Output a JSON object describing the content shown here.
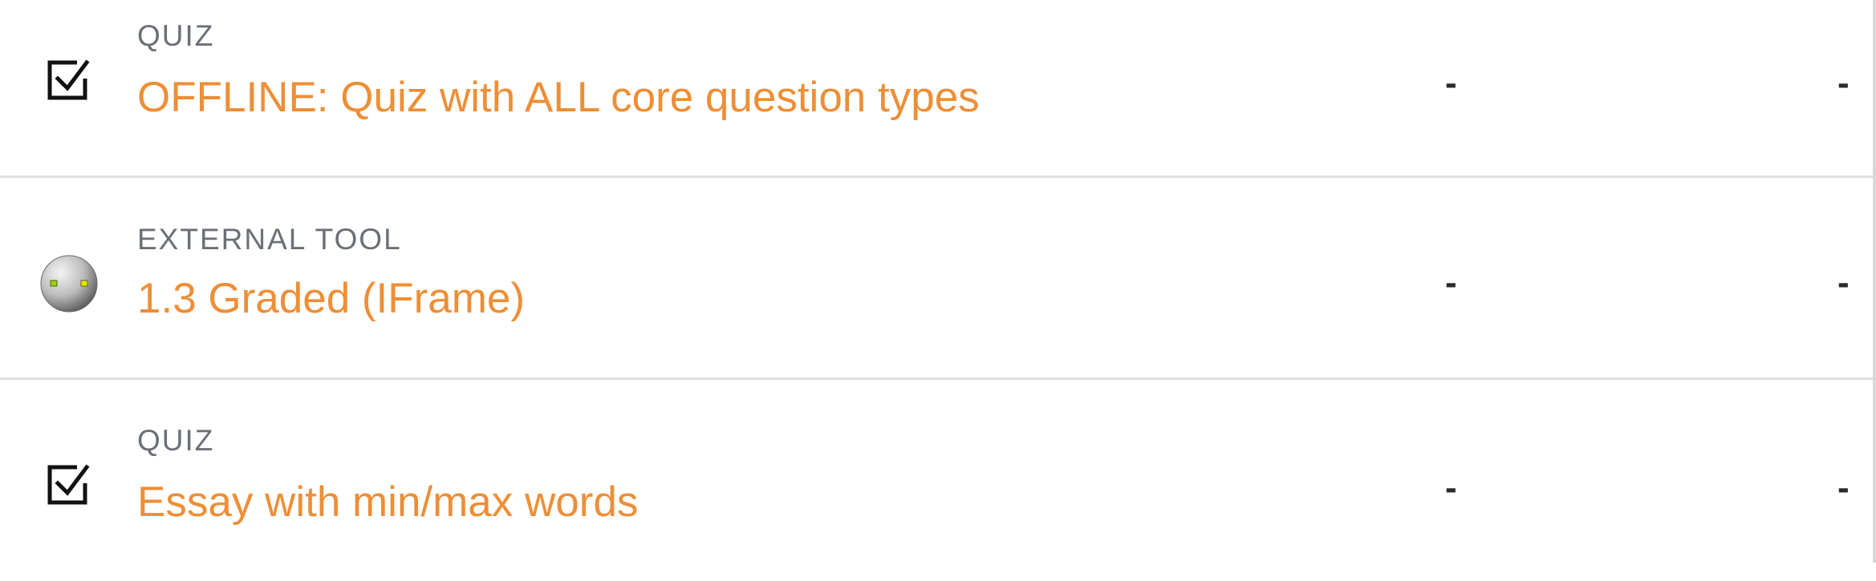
{
  "items": [
    {
      "type_label": "QUIZ",
      "title": "OFFLINE: Quiz with ALL core question types",
      "icon": "quiz-checkbox-icon",
      "col1": "-",
      "col2": "-"
    },
    {
      "type_label": "EXTERNAL TOOL",
      "title": "1.3 Graded (IFrame)",
      "icon": "external-tool-robot-icon",
      "col1": "-",
      "col2": "-"
    },
    {
      "type_label": "QUIZ",
      "title": "Essay with min/max words",
      "icon": "quiz-checkbox-icon",
      "col1": "-",
      "col2": "-"
    }
  ],
  "colors": {
    "accent": "#ee8e36",
    "label": "#6b6f76",
    "divider": "#e1e1e1"
  }
}
